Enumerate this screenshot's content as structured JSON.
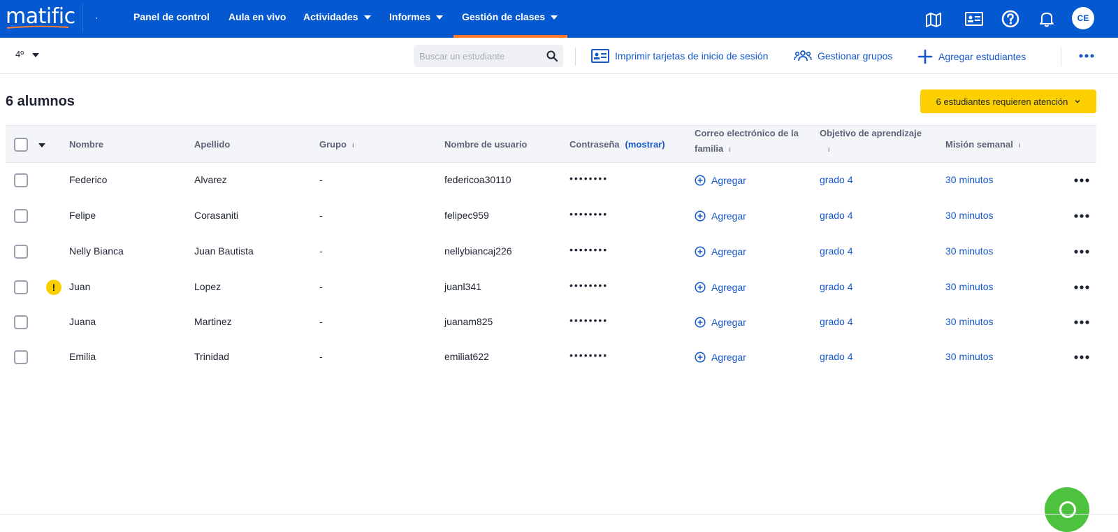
{
  "nav": {
    "logo": "matific",
    "items": [
      {
        "label": "Panel de control"
      },
      {
        "label": "Aula en vivo"
      },
      {
        "label": "Actividades"
      },
      {
        "label": "Informes"
      },
      {
        "label": "Gestión de clases"
      }
    ],
    "avatar_initials": "CE",
    "accent_color": "#0459d0",
    "active_underline_color": "#ff7a2e"
  },
  "toolbar": {
    "grade": "4º",
    "search_placeholder": "Buscar un estudiante",
    "print_cards": "Imprimir tarjetas de inicio de sesión",
    "manage_groups": "Gestionar grupos",
    "add_students": "Agregar estudiantes"
  },
  "summary": {
    "count_title": "6 alumnos",
    "attention_label": "6 estudiantes requieren atención",
    "attention_color": "#fcd000"
  },
  "table": {
    "headers": {
      "nombre": "Nombre",
      "apellido": "Apellido",
      "grupo": "Grupo",
      "usuario": "Nombre de usuario",
      "contrasena": "Contraseña",
      "mostrar": "(mostrar)",
      "correo": "Correo electrónico de la familia",
      "objetivo": "Objetivo de aprendizaje",
      "mision": "Misión semanal",
      "info": "i"
    },
    "add_label": "Agregar",
    "rows": [
      {
        "nombre": "Federico",
        "apellido": "Alvarez",
        "grupo": "-",
        "usuario": "federicoa30110",
        "password": "••••••••",
        "objetivo": "grado 4",
        "mision": "30 minutos",
        "warning": ""
      },
      {
        "nombre": "Felipe",
        "apellido": "Corasaniti",
        "grupo": "-",
        "usuario": "felipec959",
        "password": "••••••••",
        "objetivo": "grado 4",
        "mision": "30 minutos",
        "warning": ""
      },
      {
        "nombre": "Nelly Bianca",
        "apellido": "Juan Bautista",
        "grupo": "-",
        "usuario": "nellybiancaj226",
        "password": "••••••••",
        "objetivo": "grado 4",
        "mision": "30 minutos",
        "warning": ""
      },
      {
        "nombre": "Juan",
        "apellido": "Lopez",
        "grupo": "-",
        "usuario": "juanl341",
        "password": "••••••••",
        "objetivo": "grado 4",
        "mision": "30 minutos",
        "warning": "!"
      },
      {
        "nombre": "Juana",
        "apellido": "Martinez",
        "grupo": "-",
        "usuario": "juanam825",
        "password": "••••••••",
        "objetivo": "grado 4",
        "mision": "30 minutos",
        "warning": ""
      },
      {
        "nombre": "Emilia",
        "apellido": "Trinidad",
        "grupo": "-",
        "usuario": "emiliat622",
        "password": "••••••••",
        "objetivo": "grado 4",
        "mision": "30 minutos",
        "warning": ""
      }
    ]
  }
}
